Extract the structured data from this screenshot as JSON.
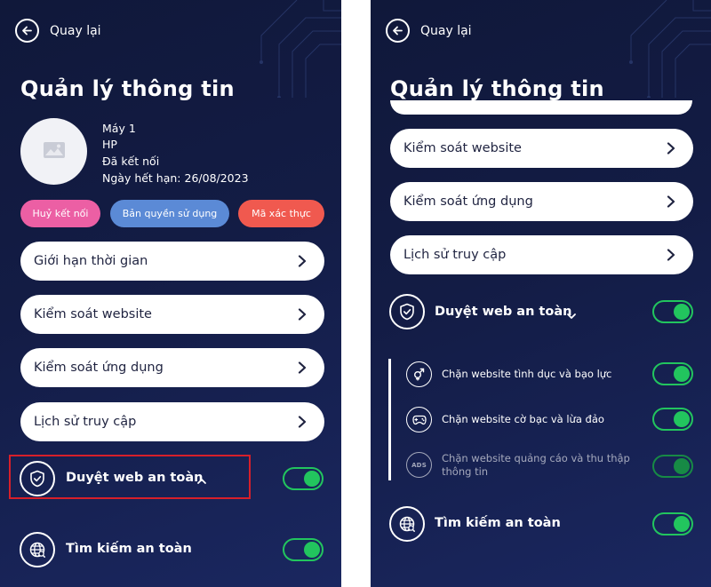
{
  "left": {
    "back_label": "Quay lại",
    "title": "Quản lý thông tin",
    "device": {
      "name": "Máy 1",
      "brand": "HP",
      "status": "Đã kết nối",
      "expiry": "Ngày hết hạn: 26/08/2023"
    },
    "actions": {
      "disconnect": "Huỷ kết nối",
      "license": "Bản quyền sử dụng",
      "auth_code": "Mã xác thực"
    },
    "menu": [
      {
        "label": "Giới hạn thời gian"
      },
      {
        "label": "Kiểm soát website"
      },
      {
        "label": "Kiểm soát ứng dụng"
      },
      {
        "label": "Lịch sử truy cập"
      }
    ],
    "safe_browsing": {
      "label": "Duyệt web an toàn",
      "enabled": true,
      "expanded": false
    },
    "safe_search": {
      "label": "Tìm kiếm an toàn",
      "enabled": true
    }
  },
  "right": {
    "back_label": "Quay lại",
    "title": "Quản lý thông tin",
    "menu": [
      {
        "label": "Kiểm soát website"
      },
      {
        "label": "Kiểm soát ứng dụng"
      },
      {
        "label": "Lịch sử truy cập"
      }
    ],
    "safe_browsing": {
      "label": "Duyệt web an toàn",
      "enabled": true,
      "expanded": true
    },
    "sub_options": [
      {
        "label": "Chặn website tình dục và bạo lực",
        "icon": "gender-icon",
        "enabled": true
      },
      {
        "label": "Chặn website cờ bạc và lừa đảo",
        "icon": "gamepad-icon",
        "enabled": true
      },
      {
        "label": "Chặn website quảng cáo và thu thập thông tin",
        "icon": "ads-icon",
        "icon_text": "ADS",
        "enabled": true,
        "dimmed": true
      }
    ],
    "safe_search": {
      "label": "Tìm kiếm an toàn",
      "enabled": true
    }
  },
  "colors": {
    "background": "#131c45",
    "toggle_on": "#22c55e",
    "btn_disconnect": "#ec5fa4",
    "btn_license": "#5b8ad6",
    "btn_auth": "#f0594f",
    "highlight": "#d71f2a"
  }
}
